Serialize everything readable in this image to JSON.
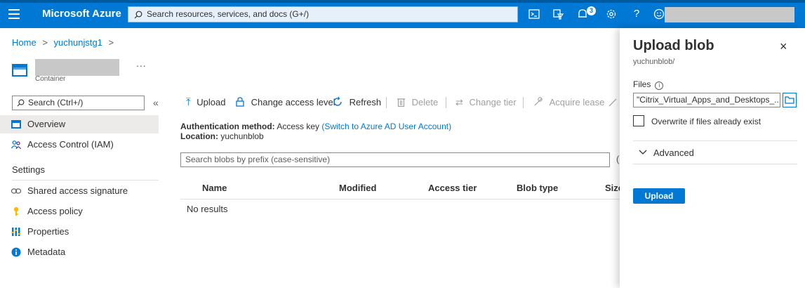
{
  "topbar": {
    "brand": "Microsoft Azure",
    "search_placeholder": "Search resources, services, and docs (G+/)",
    "notification_count": "3"
  },
  "breadcrumb": {
    "home": "Home",
    "separator": ">",
    "storage": "yuchunjstg1"
  },
  "resource": {
    "more": "...",
    "type": "Container"
  },
  "sidebar": {
    "search_placeholder": "Search (Ctrl+/)",
    "collapse": "«",
    "items": [
      {
        "label": "Overview",
        "icon": "container-icon",
        "active": true
      },
      {
        "label": "Access Control (IAM)",
        "icon": "people-icon",
        "active": false
      }
    ],
    "settings_header": "Settings",
    "settings_items": [
      {
        "label": "Shared access signature",
        "icon": "link-icon"
      },
      {
        "label": "Access policy",
        "icon": "key-icon"
      },
      {
        "label": "Properties",
        "icon": "properties-icon"
      },
      {
        "label": "Metadata",
        "icon": "info-icon"
      }
    ]
  },
  "commandbar": {
    "upload": "Upload",
    "change_access": "Change access level",
    "refresh": "Refresh",
    "delete": "Delete",
    "change_tier": "Change tier",
    "acquire_lease": "Acquire lease"
  },
  "main": {
    "auth_label": "Authentication method:",
    "auth_value": "Access key",
    "auth_link": "(Switch to Azure AD User Account)",
    "location_label": "Location:",
    "location_value": "yuchunblob",
    "search_placeholder": "Search blobs by prefix (case-sensitive)",
    "paren": "(",
    "columns": [
      "Name",
      "Modified",
      "Access tier",
      "Blob type",
      "Size"
    ],
    "empty_text": "No results"
  },
  "panel": {
    "title": "Upload blob",
    "subtitle": "yuchunblob/",
    "close": "×",
    "files_label": "Files",
    "files_value": "\"Citrix_Virtual_Apps_and_Desktops_...",
    "overwrite_label": "Overwrite if files already exist",
    "overwrite_checked": false,
    "advanced_label": "Advanced",
    "upload_button": "Upload"
  },
  "colors": {
    "accent": "#0078d4",
    "topbar": "#0078d4"
  }
}
